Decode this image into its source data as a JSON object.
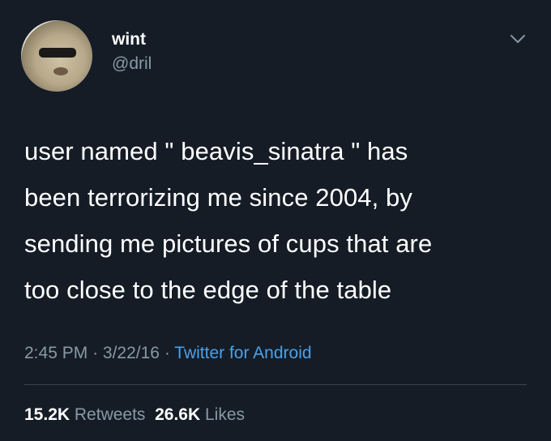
{
  "author": {
    "display_name": "wint",
    "handle": "@dril"
  },
  "icons": {
    "avatar": "profile-photo",
    "menu": "chevron-down-icon"
  },
  "tweet": {
    "text": "user named \" beavis_sinatra \" has\nbeen terrorizing me since 2004, by\nsending me pictures of cups that are\ntoo close to the edge of the table",
    "time": "2:45 PM",
    "separator": "·",
    "date": "3/22/16",
    "source": "Twitter for Android"
  },
  "stats": {
    "retweets_count": "15.2K",
    "retweets_label": "Retweets",
    "likes_count": "26.6K",
    "likes_label": "Likes"
  },
  "colors": {
    "background": "#151c26",
    "secondary_text": "#8899a6",
    "link": "#4aa1eb"
  }
}
